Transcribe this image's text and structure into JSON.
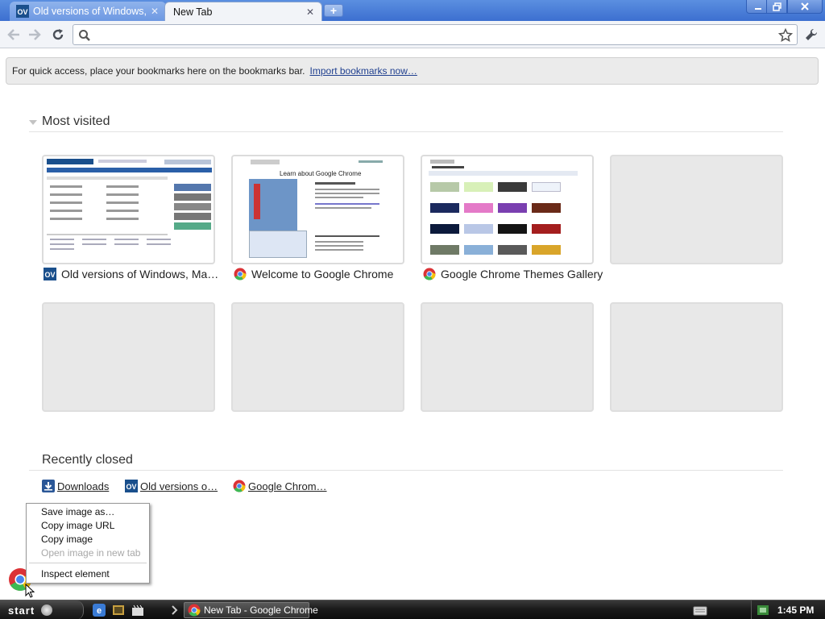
{
  "tabs": [
    {
      "title": "Old versions of Windows, Mac, Linux",
      "favicon": "ov-icon",
      "active": false
    },
    {
      "title": "New Tab",
      "favicon": "",
      "active": true
    }
  ],
  "omnibox": {
    "value": "",
    "placeholder": ""
  },
  "bookmark_bar": {
    "message": "For quick access, place your bookmarks here on the bookmarks bar.",
    "link": "Import bookmarks now…"
  },
  "most_visited": {
    "heading": "Most visited",
    "tiles": [
      {
        "title": "Old versions of Windows, Ma…",
        "favicon": "ov-icon",
        "preview": "oldversion-page"
      },
      {
        "title": "Welcome to Google Chrome",
        "favicon": "chrome-icon",
        "preview": "welcome-page",
        "preview_heading": "Learn about Google Chrome"
      },
      {
        "title": "Google Chrome Themes Gallery",
        "favicon": "chrome-icon",
        "preview": "themes-page"
      },
      {
        "title": "",
        "favicon": "",
        "preview": "empty"
      },
      {
        "title": "",
        "favicon": "",
        "preview": "empty"
      },
      {
        "title": "",
        "favicon": "",
        "preview": "empty"
      },
      {
        "title": "",
        "favicon": "",
        "preview": "empty"
      },
      {
        "title": "",
        "favicon": "",
        "preview": "empty"
      }
    ]
  },
  "recently_closed": {
    "heading": "Recently closed",
    "items": [
      {
        "label": "Downloads",
        "favicon": "download-icon"
      },
      {
        "label": "Old versions o…",
        "favicon": "ov-icon"
      },
      {
        "label": "Google Chrom…",
        "favicon": "chrome-icon"
      }
    ]
  },
  "context_menu": {
    "items": [
      {
        "label": "Save image as…",
        "enabled": true
      },
      {
        "label": "Copy image URL",
        "enabled": true
      },
      {
        "label": "Copy image",
        "enabled": true
      },
      {
        "label": "Open image in new tab",
        "enabled": false
      },
      {
        "label": "Inspect element",
        "enabled": true
      }
    ]
  },
  "taskbar": {
    "start_label": "start",
    "task_label": "New Tab - Google Chrome",
    "clock": "1:45 PM"
  },
  "colors": {
    "tabstrip": "#3c6fd0",
    "chrome_red": "#db3236",
    "chrome_green": "#3cba54",
    "chrome_yellow": "#f4c20d",
    "chrome_blue": "#4885ed",
    "ov_badge": "#1a4f8c"
  }
}
